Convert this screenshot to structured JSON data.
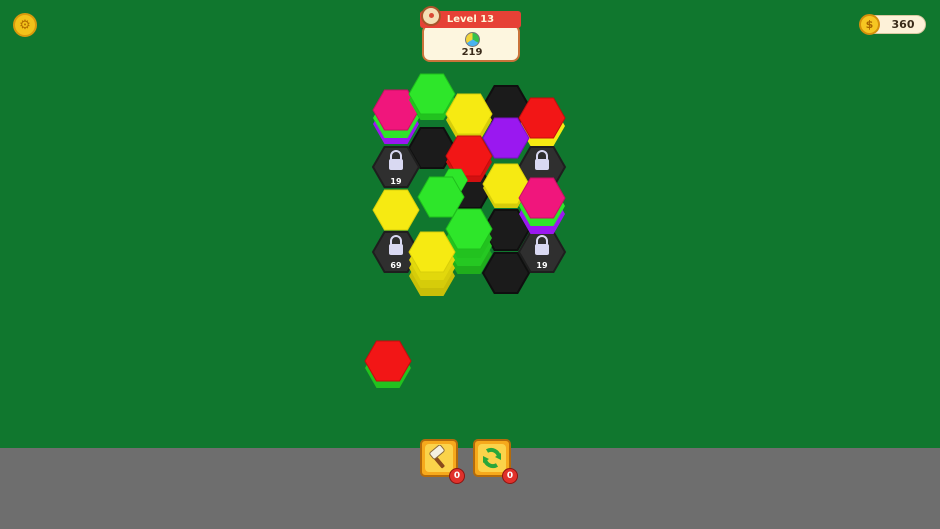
{
  "hud": {
    "level_label": "Level 13",
    "target_count": "219",
    "coins": "360",
    "coin_icon": "coin-icon",
    "settings_icon": "settings-gear-icon"
  },
  "boosters": [
    {
      "name": "hammer",
      "icon": "hammer-icon",
      "count": "0"
    },
    {
      "name": "swap",
      "icon": "swap-arrows-icon",
      "count": "0"
    }
  ],
  "board": {
    "locked_cells": [
      {
        "count": "19"
      },
      {
        "count": "19"
      },
      {
        "count": "69"
      },
      {
        "count": "19"
      }
    ]
  },
  "colors": {
    "background": "#10772e",
    "pink": "#f0167c",
    "green": "#2ee62a",
    "yellow": "#f6ea12",
    "purple": "#9a18f0",
    "red": "#f21616",
    "black": "#1b1b1b",
    "locked": "#2f2f2f"
  }
}
